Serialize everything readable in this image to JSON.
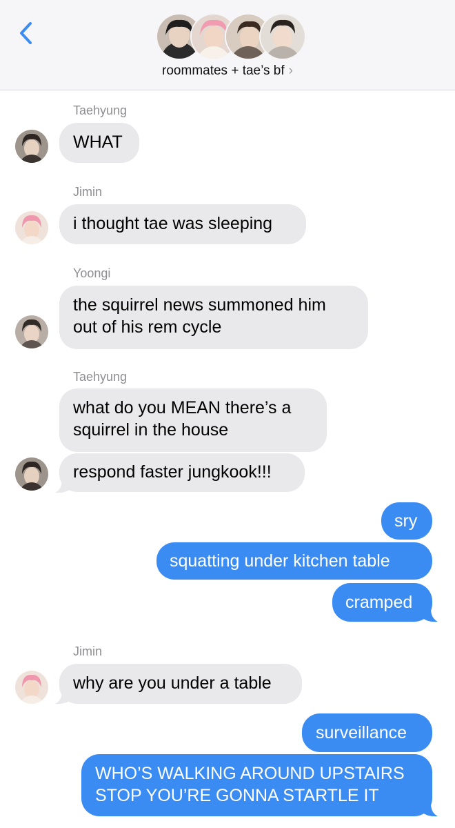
{
  "header": {
    "back_icon": "chevron-left-icon",
    "group_name": "roommates + tae’s bf",
    "chevron": "›",
    "accent": "#3a8cf3"
  },
  "messages": [
    {
      "sender": "Taehyung",
      "text": "WHAT"
    },
    {
      "sender": "Jimin",
      "text": "i thought tae was sleeping"
    },
    {
      "sender": "Yoongi",
      "line1": "the squirrel news summoned him",
      "line2": "out of his rem cycle"
    },
    {
      "sender": "Taehyung",
      "line1": "what do you MEAN there’s a",
      "line2": "squirrel in the house"
    },
    {
      "text": "respond faster jungkook!!!"
    },
    {
      "text": "sry"
    },
    {
      "text": "squatting under kitchen table"
    },
    {
      "text": "cramped"
    },
    {
      "sender": "Jimin",
      "text": "why are you under a table"
    },
    {
      "text": "surveillance"
    },
    {
      "line1": "WHO’S WALKING AROUND UPSTAIRS",
      "line2": "STOP YOU’RE GONNA STARTLE IT"
    }
  ],
  "colors": {
    "incoming_bubble": "#e9e9eb",
    "outgoing_bubble": "#3a8cf3",
    "sender_label": "#8e8e93"
  }
}
